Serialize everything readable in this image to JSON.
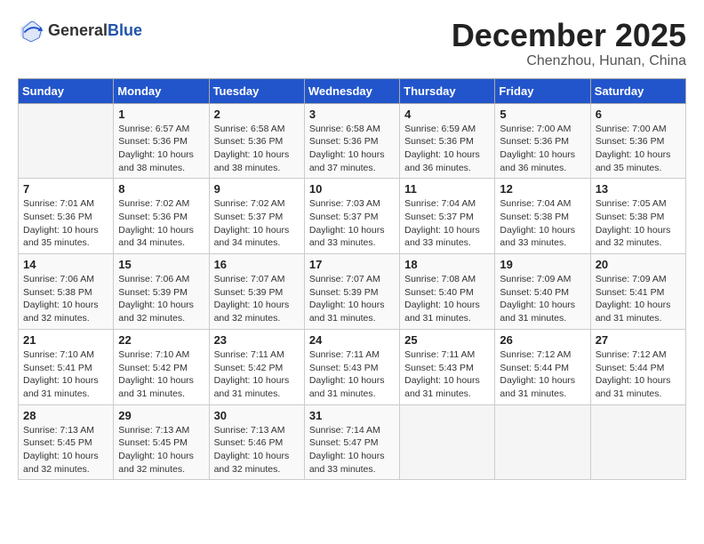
{
  "logo": {
    "general": "General",
    "blue": "Blue"
  },
  "title": "December 2025",
  "subtitle": "Chenzhou, Hunan, China",
  "days_of_week": [
    "Sunday",
    "Monday",
    "Tuesday",
    "Wednesday",
    "Thursday",
    "Friday",
    "Saturday"
  ],
  "weeks": [
    [
      {
        "day": "",
        "info": ""
      },
      {
        "day": "1",
        "info": "Sunrise: 6:57 AM\nSunset: 5:36 PM\nDaylight: 10 hours\nand 38 minutes."
      },
      {
        "day": "2",
        "info": "Sunrise: 6:58 AM\nSunset: 5:36 PM\nDaylight: 10 hours\nand 38 minutes."
      },
      {
        "day": "3",
        "info": "Sunrise: 6:58 AM\nSunset: 5:36 PM\nDaylight: 10 hours\nand 37 minutes."
      },
      {
        "day": "4",
        "info": "Sunrise: 6:59 AM\nSunset: 5:36 PM\nDaylight: 10 hours\nand 36 minutes."
      },
      {
        "day": "5",
        "info": "Sunrise: 7:00 AM\nSunset: 5:36 PM\nDaylight: 10 hours\nand 36 minutes."
      },
      {
        "day": "6",
        "info": "Sunrise: 7:00 AM\nSunset: 5:36 PM\nDaylight: 10 hours\nand 35 minutes."
      }
    ],
    [
      {
        "day": "7",
        "info": "Sunrise: 7:01 AM\nSunset: 5:36 PM\nDaylight: 10 hours\nand 35 minutes."
      },
      {
        "day": "8",
        "info": "Sunrise: 7:02 AM\nSunset: 5:36 PM\nDaylight: 10 hours\nand 34 minutes."
      },
      {
        "day": "9",
        "info": "Sunrise: 7:02 AM\nSunset: 5:37 PM\nDaylight: 10 hours\nand 34 minutes."
      },
      {
        "day": "10",
        "info": "Sunrise: 7:03 AM\nSunset: 5:37 PM\nDaylight: 10 hours\nand 33 minutes."
      },
      {
        "day": "11",
        "info": "Sunrise: 7:04 AM\nSunset: 5:37 PM\nDaylight: 10 hours\nand 33 minutes."
      },
      {
        "day": "12",
        "info": "Sunrise: 7:04 AM\nSunset: 5:38 PM\nDaylight: 10 hours\nand 33 minutes."
      },
      {
        "day": "13",
        "info": "Sunrise: 7:05 AM\nSunset: 5:38 PM\nDaylight: 10 hours\nand 32 minutes."
      }
    ],
    [
      {
        "day": "14",
        "info": "Sunrise: 7:06 AM\nSunset: 5:38 PM\nDaylight: 10 hours\nand 32 minutes."
      },
      {
        "day": "15",
        "info": "Sunrise: 7:06 AM\nSunset: 5:39 PM\nDaylight: 10 hours\nand 32 minutes."
      },
      {
        "day": "16",
        "info": "Sunrise: 7:07 AM\nSunset: 5:39 PM\nDaylight: 10 hours\nand 32 minutes."
      },
      {
        "day": "17",
        "info": "Sunrise: 7:07 AM\nSunset: 5:39 PM\nDaylight: 10 hours\nand 31 minutes."
      },
      {
        "day": "18",
        "info": "Sunrise: 7:08 AM\nSunset: 5:40 PM\nDaylight: 10 hours\nand 31 minutes."
      },
      {
        "day": "19",
        "info": "Sunrise: 7:09 AM\nSunset: 5:40 PM\nDaylight: 10 hours\nand 31 minutes."
      },
      {
        "day": "20",
        "info": "Sunrise: 7:09 AM\nSunset: 5:41 PM\nDaylight: 10 hours\nand 31 minutes."
      }
    ],
    [
      {
        "day": "21",
        "info": "Sunrise: 7:10 AM\nSunset: 5:41 PM\nDaylight: 10 hours\nand 31 minutes."
      },
      {
        "day": "22",
        "info": "Sunrise: 7:10 AM\nSunset: 5:42 PM\nDaylight: 10 hours\nand 31 minutes."
      },
      {
        "day": "23",
        "info": "Sunrise: 7:11 AM\nSunset: 5:42 PM\nDaylight: 10 hours\nand 31 minutes."
      },
      {
        "day": "24",
        "info": "Sunrise: 7:11 AM\nSunset: 5:43 PM\nDaylight: 10 hours\nand 31 minutes."
      },
      {
        "day": "25",
        "info": "Sunrise: 7:11 AM\nSunset: 5:43 PM\nDaylight: 10 hours\nand 31 minutes."
      },
      {
        "day": "26",
        "info": "Sunrise: 7:12 AM\nSunset: 5:44 PM\nDaylight: 10 hours\nand 31 minutes."
      },
      {
        "day": "27",
        "info": "Sunrise: 7:12 AM\nSunset: 5:44 PM\nDaylight: 10 hours\nand 31 minutes."
      }
    ],
    [
      {
        "day": "28",
        "info": "Sunrise: 7:13 AM\nSunset: 5:45 PM\nDaylight: 10 hours\nand 32 minutes."
      },
      {
        "day": "29",
        "info": "Sunrise: 7:13 AM\nSunset: 5:45 PM\nDaylight: 10 hours\nand 32 minutes."
      },
      {
        "day": "30",
        "info": "Sunrise: 7:13 AM\nSunset: 5:46 PM\nDaylight: 10 hours\nand 32 minutes."
      },
      {
        "day": "31",
        "info": "Sunrise: 7:14 AM\nSunset: 5:47 PM\nDaylight: 10 hours\nand 33 minutes."
      },
      {
        "day": "",
        "info": ""
      },
      {
        "day": "",
        "info": ""
      },
      {
        "day": "",
        "info": ""
      }
    ]
  ]
}
